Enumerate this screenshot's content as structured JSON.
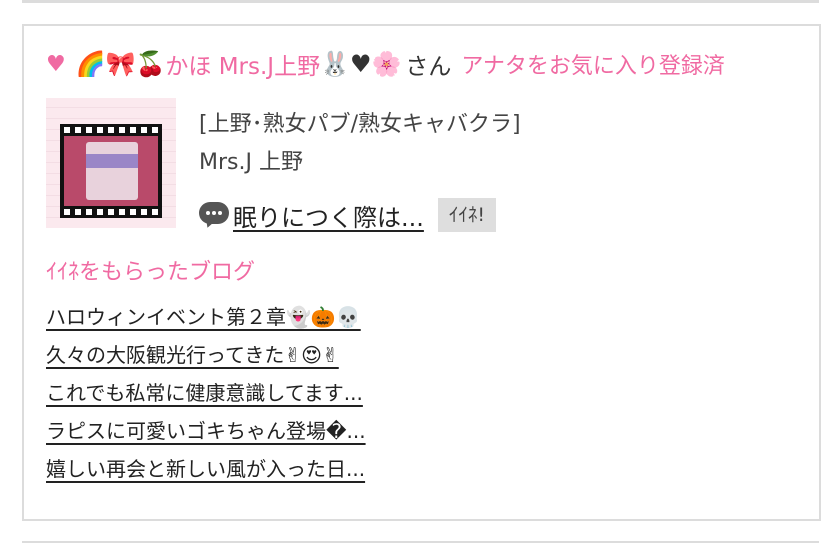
{
  "header": {
    "heart": "♥",
    "emojis_before": "🌈🎀🍒",
    "user_name": "かほ Mrs.J上野",
    "emojis_after": "🐰♥🌸",
    "honorific": "さん",
    "favorite_status": "アナタをお気に入り登録済"
  },
  "shop": {
    "genre": "[上野･熟女パブ/熟女キャバクラ]",
    "name": "Mrs.J 上野"
  },
  "blog": {
    "title": "眠りにつく際は...",
    "like_button": "ｲｲﾈ!"
  },
  "liked_section": {
    "title": "ｲｲﾈをもらったブログ",
    "items": [
      "ハロウィンイベント第２章👻🎃💀",
      "久々の大阪観光行ってきた✌😍✌",
      "これでも私常に健康意識してます...",
      "ラピスに可愛いゴキちゃん登場�...",
      "嬉しい再会と新しい風が入った日..."
    ]
  },
  "icons": {
    "bubble": "speech-bubble-icon",
    "heart_color": "#f06aa2"
  }
}
